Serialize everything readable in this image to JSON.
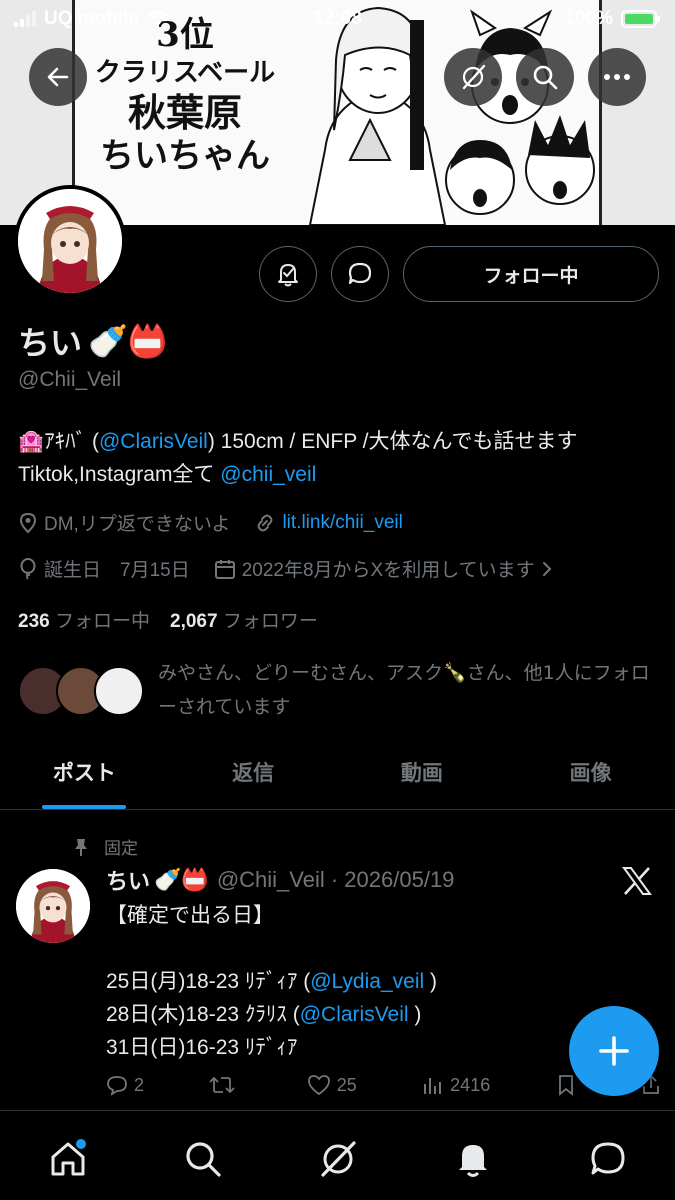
{
  "status_bar": {
    "carrier": "UQ mobile",
    "time": "12:08",
    "battery": "100%"
  },
  "banner": {
    "line1": "3位",
    "line2": "クラリスベール",
    "line3": "秋葉原",
    "line4": "ちいちゃん"
  },
  "header_buttons": {
    "back": "back-arrow-icon",
    "grok": "grok-icon",
    "search": "search-icon",
    "more": "more-icon"
  },
  "profile": {
    "name": "ちい",
    "name_emojis": "🍼📛",
    "handle": "@Chii_Veil",
    "follow_label": "フォロー中",
    "bio": {
      "prefix_emoji": "🏩",
      "part1": "ｱｷﾊﾞ (",
      "mention1": "@ClarisVeil",
      "part2": ") 150cm / ENFP /大体なんでも話せます Tiktok,Instagram全て ",
      "mention2": "@chii_veil"
    },
    "location": "DM,リプ返できないよ",
    "website": "lit.link/chii_veil",
    "birthday": "誕生日　7月15日",
    "joined": "2022年8月からXを利用しています",
    "following_count": "236",
    "following_label": "フォロー中",
    "followers_count": "2,067",
    "followers_label": "フォロワー",
    "followed_by": "みやさん、どりーむさん、アスク🍾さん、他1人にフォローされています"
  },
  "tabs": [
    "ポスト",
    "返信",
    "動画",
    "画像"
  ],
  "pinned_label": "固定",
  "tweet": {
    "name": "ちい",
    "name_emojis": "🍼📛",
    "handle_date": "@Chii_Veil · 2026/05/19",
    "lines": [
      {
        "text": "【確定で出る日】",
        "mention": "",
        "tail": ""
      },
      {
        "text": "",
        "mention": "",
        "tail": ""
      },
      {
        "text": "25日(月)18-23 ﾘﾃﾞｨｱ (",
        "mention": "@Lydia_veil",
        "tail": " )"
      },
      {
        "text": "28日(木)18-23 ｸﾗﾘｽ (",
        "mention": "@ClarisVeil",
        "tail": " )"
      },
      {
        "text": "31日(日)16-23 ﾘﾃﾞｨｱ",
        "mention": "",
        "tail": ""
      }
    ],
    "replies": "2",
    "retweets": "",
    "likes": "25",
    "views": "2416"
  },
  "colors": {
    "accent": "#1d9bf0",
    "muted": "#71767b",
    "text": "#e7e9ea",
    "bg": "#000000"
  }
}
